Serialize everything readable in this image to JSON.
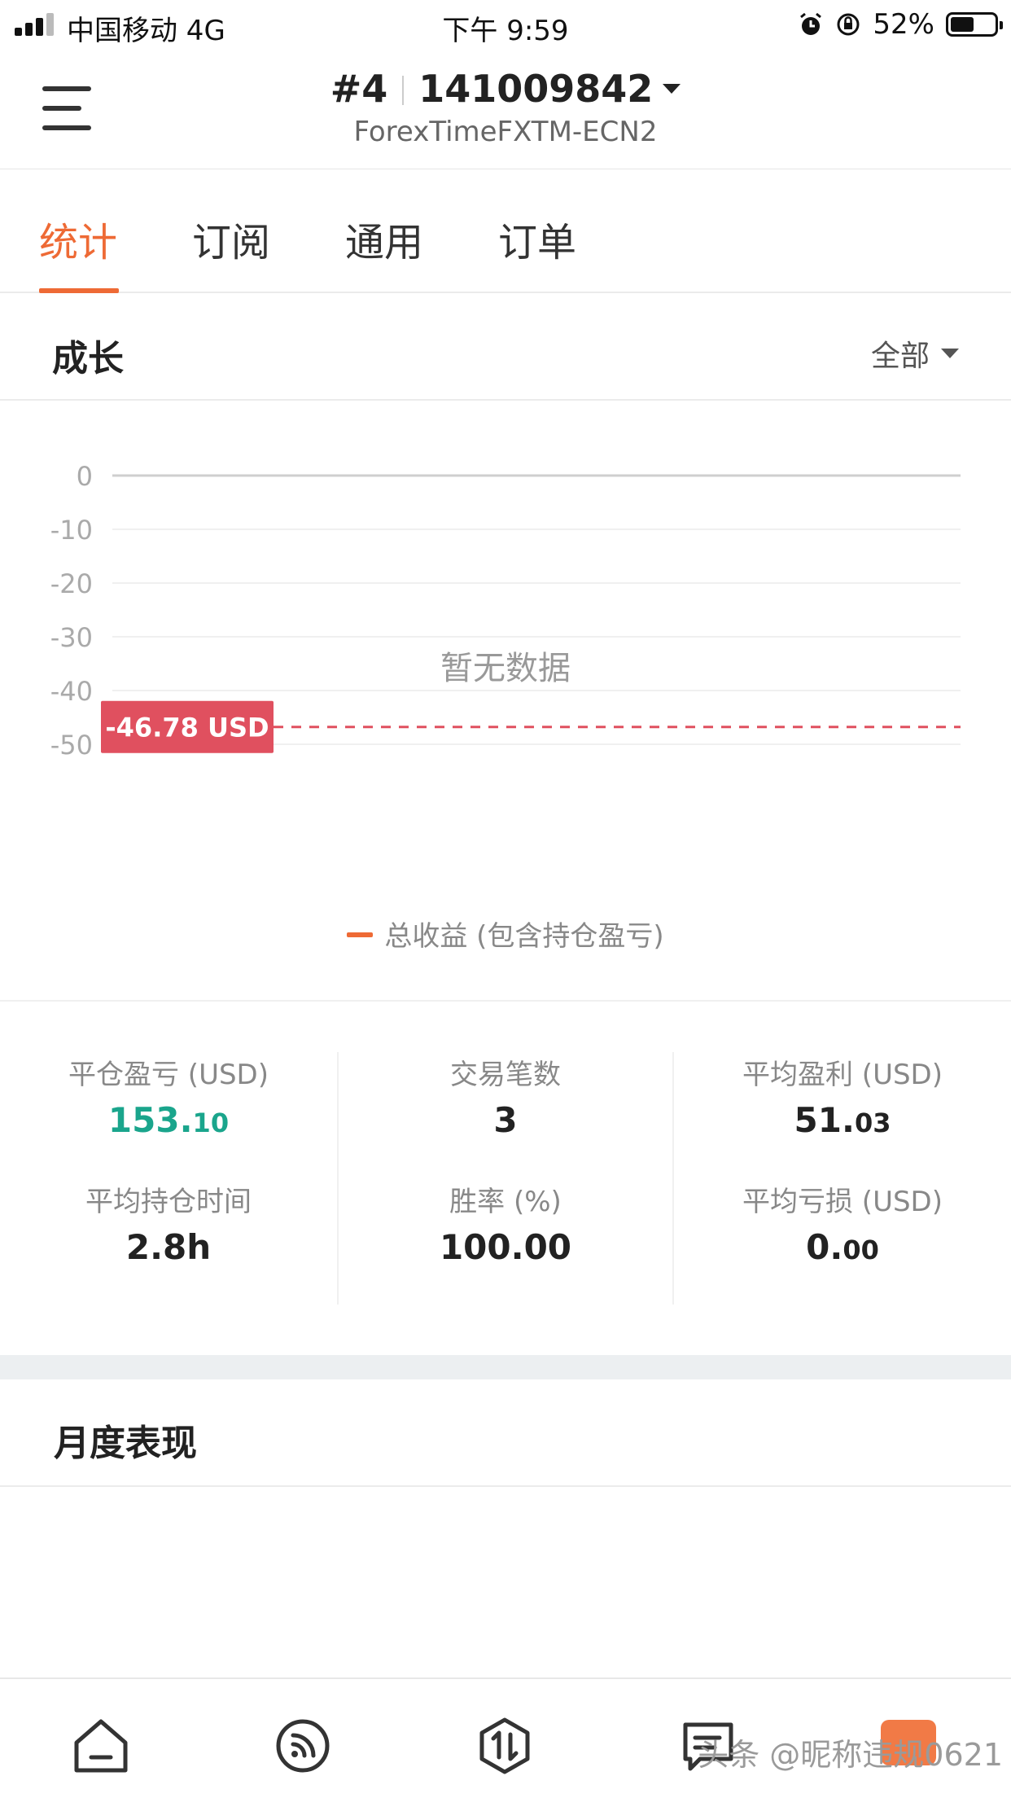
{
  "status_bar": {
    "carrier": "中国移动 4G",
    "time": "下午 9:59",
    "battery_percent": "52%",
    "battery_level": 0.52
  },
  "header": {
    "account_index": "#4",
    "account_number": "141009842",
    "server": "ForexTimeFXTM-ECN2"
  },
  "tabs": [
    {
      "label": "统计",
      "active": true
    },
    {
      "label": "订阅",
      "active": false
    },
    {
      "label": "通用",
      "active": false
    },
    {
      "label": "订单",
      "active": false
    }
  ],
  "growth": {
    "title": "成长",
    "filter_label": "全部"
  },
  "chart_data": {
    "type": "line",
    "y_ticks": [
      "0",
      "-10",
      "-20",
      "-30",
      "-40",
      "-50"
    ],
    "ylim": [
      -50,
      0
    ],
    "series": [
      {
        "name": "总收益 (包含持仓盈亏)",
        "values": []
      }
    ],
    "empty_text": "暂无数据",
    "reference_line": {
      "value": -46.78,
      "label": "-46.78 USD",
      "color": "#e0505f"
    },
    "series_color": "#ee6a35"
  },
  "stats": {
    "closed_pl": {
      "label": "平仓盈亏 (USD)",
      "int": "153.",
      "dec": "10"
    },
    "trades": {
      "label": "交易笔数",
      "value": "3"
    },
    "avg_profit": {
      "label": "平均盈利 (USD)",
      "int": "51.",
      "dec": "03"
    },
    "avg_hold": {
      "label": "平均持仓时间",
      "value": "2.8h"
    },
    "win_rate": {
      "label": "胜率 (%)",
      "value": "100.00"
    },
    "avg_loss": {
      "label": "平均亏损 (USD)",
      "int": "0.",
      "dec": "00"
    }
  },
  "monthly": {
    "title": "月度表现"
  },
  "bottom_nav": {
    "items": [
      "home-icon",
      "feed-icon",
      "trade-icon",
      "messages-icon"
    ],
    "watermark": "头条 @昵称违规0621"
  }
}
